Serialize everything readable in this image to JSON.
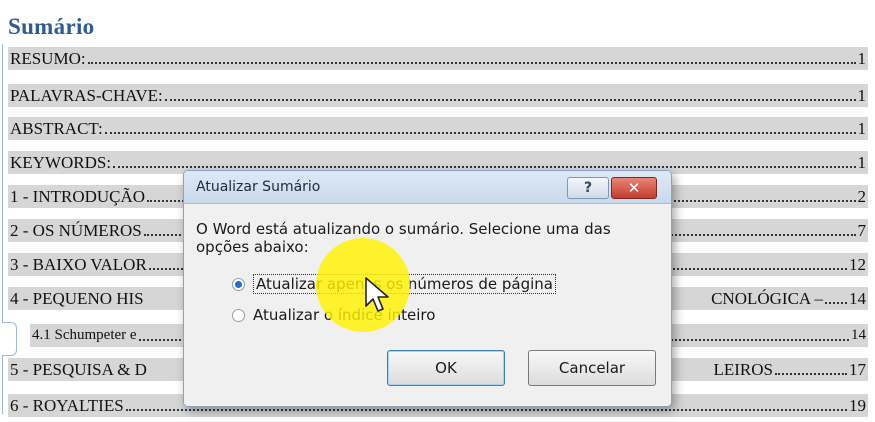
{
  "document": {
    "toc_title": "Sumário",
    "entries": [
      {
        "text": "RESUMO:",
        "page": "1"
      },
      {
        "text": "PALAVRAS-CHAVE:",
        "page": "1"
      },
      {
        "text": "ABSTRACT:",
        "page": "1"
      },
      {
        "text": "KEYWORDS:",
        "page": "1"
      },
      {
        "text": "1 - INTRODUÇÃO",
        "page": "2"
      },
      {
        "text": "2 - OS NÚMEROS",
        "page": "7"
      },
      {
        "text": "3 - BAIXO VALOR",
        "page": "12"
      },
      {
        "text": "4 - PEQUENO HIS",
        "tail": "CNOLÓGICA –",
        "page": "14"
      },
      {
        "text": "4.1 Schumpeter e",
        "page": "14"
      },
      {
        "text": "5 - PESQUISA & D",
        "tail": "LEIROS",
        "page": "17"
      },
      {
        "text": "6 - ROYALTIES",
        "page": "19"
      }
    ]
  },
  "dialog": {
    "title": "Atualizar Sumário",
    "help_label": "?",
    "close_label": "✕",
    "message": "O Word está atualizando o sumário. Selecione uma das opções abaixo:",
    "options": [
      {
        "label": "Atualizar apenas os números de página",
        "checked": true
      },
      {
        "label": "Atualizar o índice inteiro",
        "checked": false
      }
    ],
    "ok_label": "OK",
    "cancel_label": "Cancelar"
  },
  "cursor": {
    "icon": "pointer-arrow-icon",
    "highlight_color": "#fff200"
  }
}
